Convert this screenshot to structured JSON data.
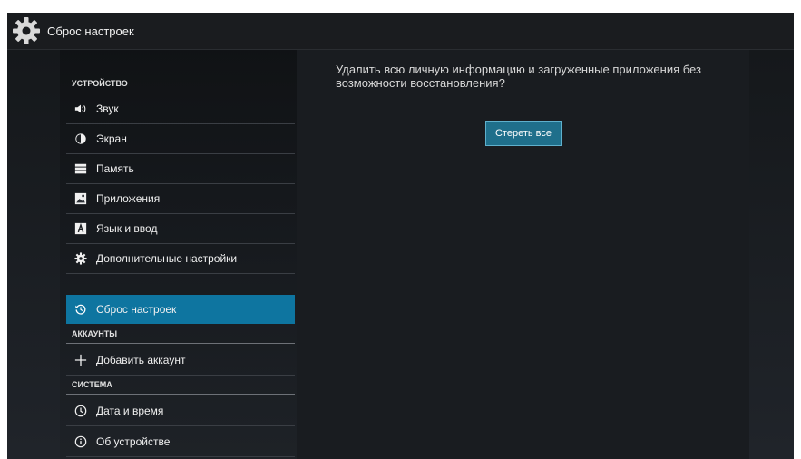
{
  "titlebar": {
    "title": "Сброс настроек",
    "icon": "gear-icon"
  },
  "sidebar": {
    "sections": {
      "device": "УСТРОЙСТВО",
      "accounts": "АККАУНТЫ",
      "system": "СИСТЕМА"
    },
    "items": [
      {
        "label": "Звук",
        "icon": "volume-icon"
      },
      {
        "label": "Экран",
        "icon": "brightness-icon"
      },
      {
        "label": "Память",
        "icon": "storage-icon"
      },
      {
        "label": "Приложения",
        "icon": "apps-icon"
      },
      {
        "label": "Язык и ввод",
        "icon": "language-icon"
      },
      {
        "label": "Дополнительные настройки",
        "icon": "gear-icon"
      },
      {
        "label": "Сброс настроек",
        "icon": "reset-icon",
        "selected": true
      },
      {
        "label": "Добавить аккаунт",
        "icon": "plus-icon"
      },
      {
        "label": "Дата и время",
        "icon": "clock-icon"
      },
      {
        "label": "Об устройстве",
        "icon": "info-icon"
      }
    ]
  },
  "content": {
    "message": "Удалить всю личную информацию и загруженные приложения без возможности восстановления?",
    "erase_button": "Стереть все"
  },
  "colors": {
    "accent": "#0e75a0",
    "button": "#1f6f8b"
  }
}
